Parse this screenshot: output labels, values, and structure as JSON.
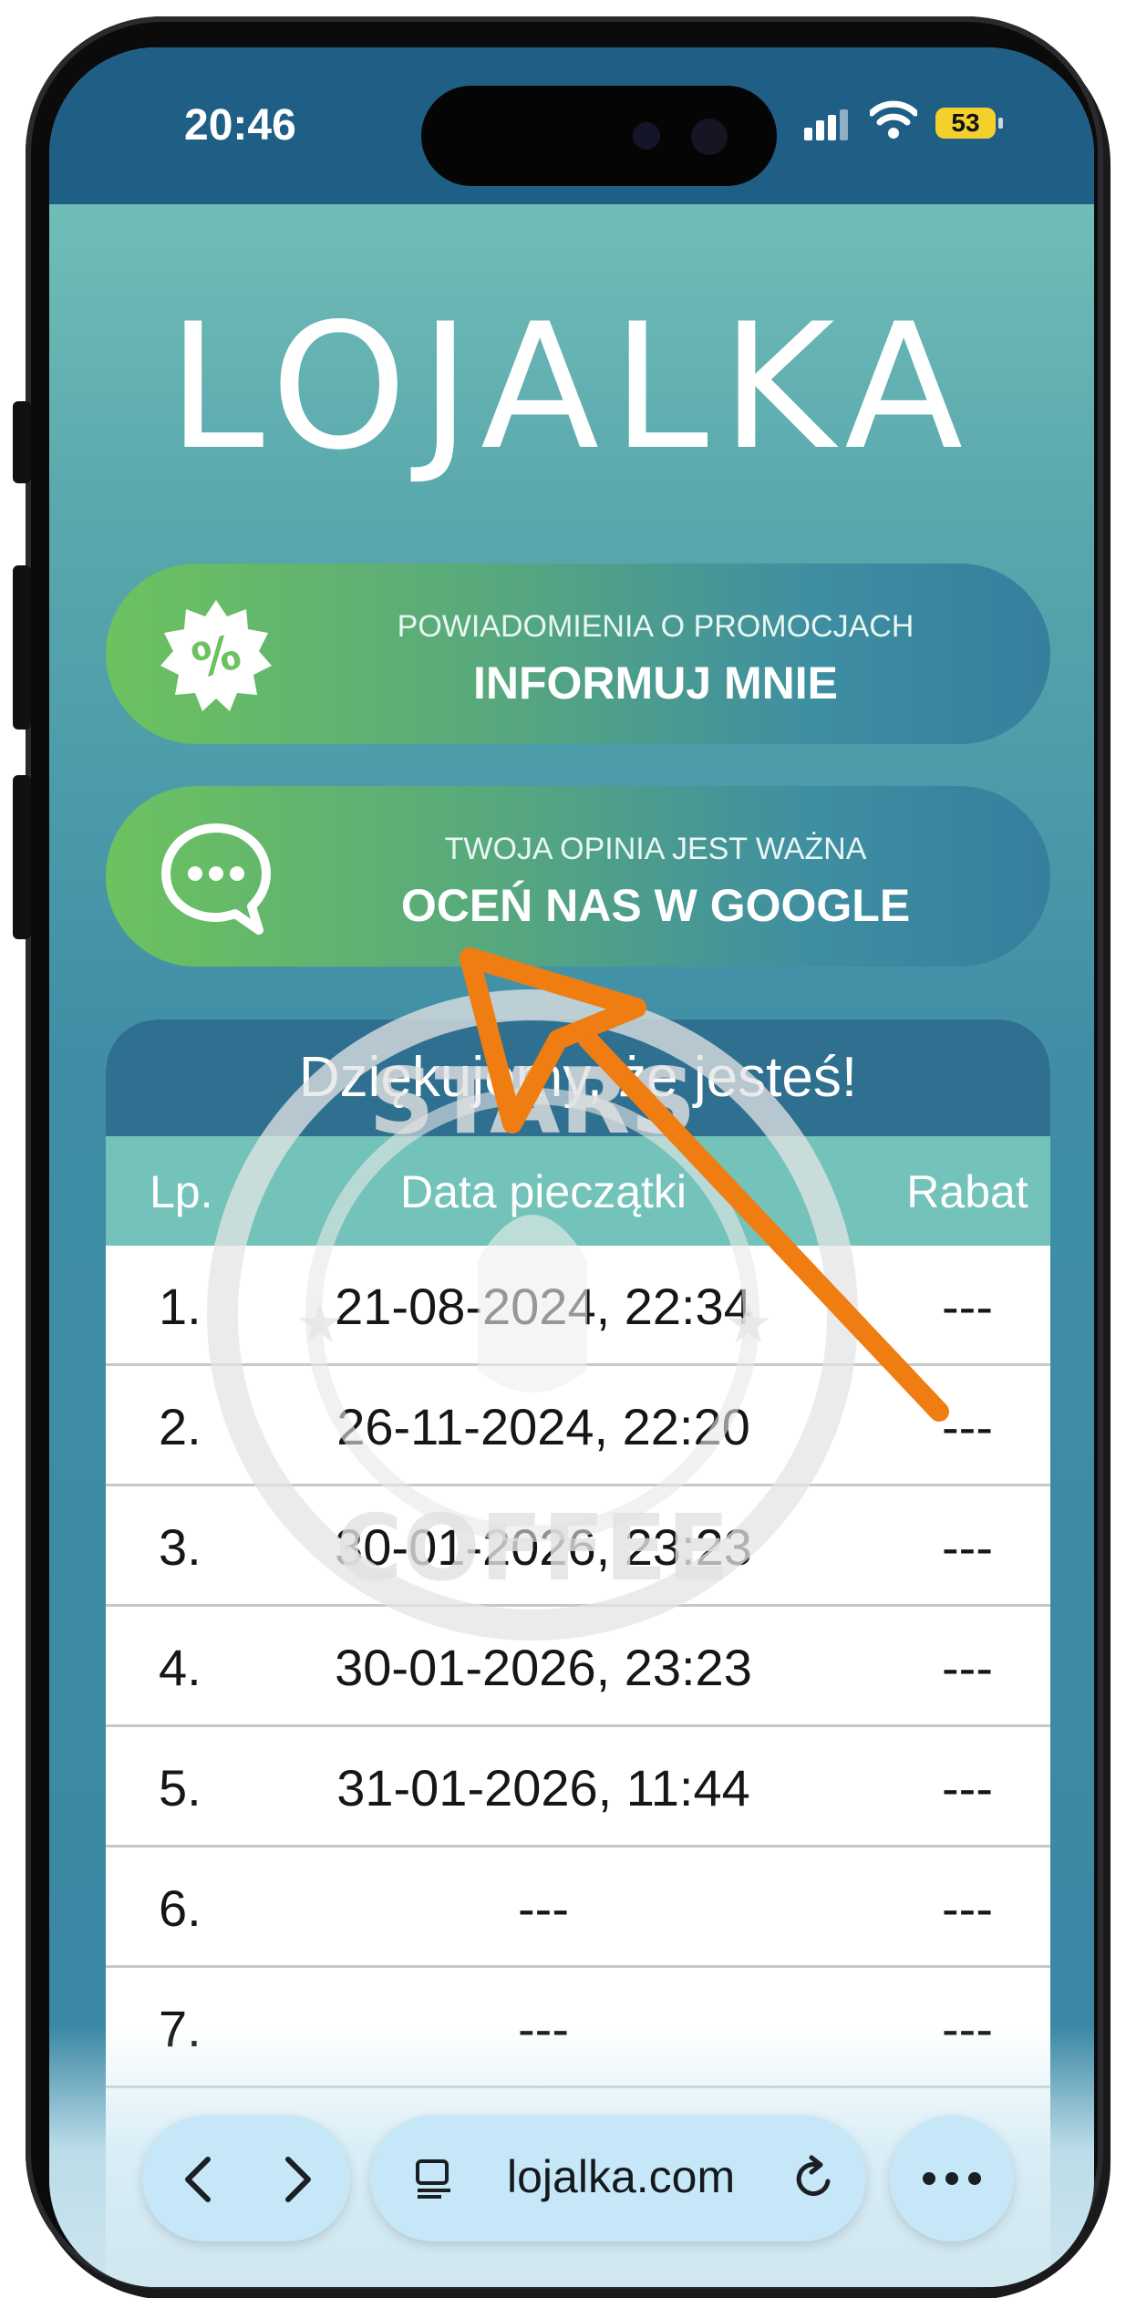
{
  "status_bar": {
    "time": "20:46",
    "battery": "53"
  },
  "logo_text": "LOJALKA",
  "buttons": [
    {
      "subtitle": "POWIADOMIENIA O PROMOCJACH",
      "title": "INFORMUJ MNIE",
      "icon": "percent-badge-icon"
    },
    {
      "subtitle": "TWOJA OPINIA JEST WAŻNA",
      "title": "OCEŃ NAS W GOOGLE",
      "icon": "chat-bubble-icon"
    }
  ],
  "table": {
    "title": "Dziękujemy, że jesteś!",
    "columns": [
      "Lp.",
      "Data pieczątki",
      "Rabat"
    ],
    "rows": [
      [
        "1.",
        "21-08-2024, 22:34",
        "---"
      ],
      [
        "2.",
        "26-11-2024, 22:20",
        "---"
      ],
      [
        "3.",
        "30-01-2026, 23:23",
        "---"
      ],
      [
        "4.",
        "30-01-2026, 23:23",
        "---"
      ],
      [
        "5.",
        "31-01-2026, 11:44",
        "---"
      ],
      [
        "6.",
        "---",
        "---"
      ],
      [
        "7.",
        "---",
        "---"
      ]
    ]
  },
  "watermark_text": [
    "STARS",
    "COFFEE"
  ],
  "browser": {
    "url": "lojalka.com"
  },
  "colors": {
    "annotation_arrow": "#f07d12",
    "header_dark": "#2f6f8f",
    "header_light": "#73c3ba"
  }
}
